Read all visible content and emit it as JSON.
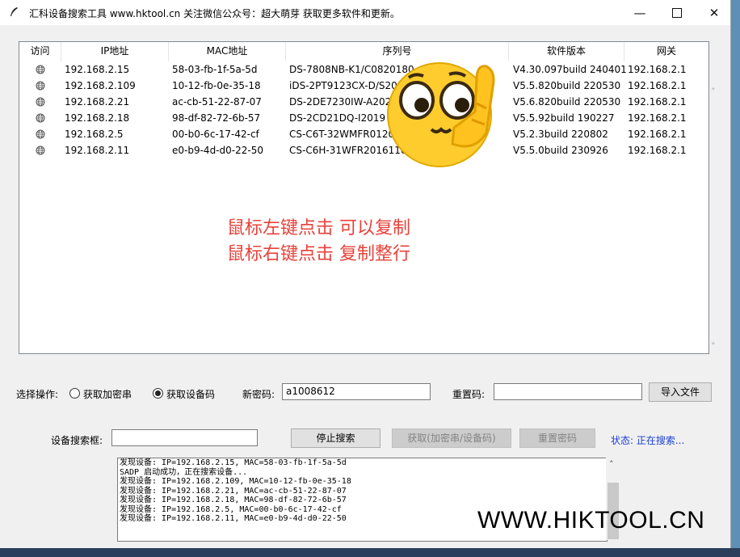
{
  "window": {
    "title": "汇科设备搜索工具  www.hktool.cn  关注微信公众号：超大萌芽  获取更多软件和更新。"
  },
  "table": {
    "columns": [
      "访问",
      "IP地址",
      "MAC地址",
      "序列号",
      "软件版本",
      "网关"
    ],
    "rows": [
      {
        "ip": "192.168.2.15",
        "mac": "58-03-fb-1f-5a-5d",
        "serial": "DS-7808NB-K1/C0820180",
        "version": "V4.30.097build 240401",
        "gateway": "192.168.2.1"
      },
      {
        "ip": "192.168.2.109",
        "mac": "10-12-fb-0e-35-18",
        "serial": "iDS-2PT9123CX-D/S20",
        "version": "V5.5.820build 220530",
        "gateway": "192.168.2.1"
      },
      {
        "ip": "192.168.2.21",
        "mac": "ac-cb-51-22-87-07",
        "serial": "DS-2DE7230IW-A202",
        "version": "V5.6.820build 220530",
        "gateway": "192.168.2.1"
      },
      {
        "ip": "192.168.2.18",
        "mac": "98-df-82-72-6b-57",
        "serial": "DS-2CD21DQ-I2019",
        "version": "V5.5.92build 190227",
        "gateway": "192.168.2.1"
      },
      {
        "ip": "192.168.2.5",
        "mac": "00-b0-6c-17-42-cf",
        "serial": "CS-C6T-32WMFR0120",
        "version": "V5.2.3build 220802",
        "gateway": "192.168.2.1"
      },
      {
        "ip": "192.168.2.11",
        "mac": "e0-b9-4d-d0-22-50",
        "serial": "CS-C6H-31WFR2016110",
        "version": "V5.5.0build 230926",
        "gateway": "192.168.2.1"
      }
    ]
  },
  "overlay": {
    "line1": "鼠标左键点击 可以复制",
    "line2": "鼠标右键点击 复制整行",
    "color": "#e8423a"
  },
  "controls": {
    "operation_label": "选择操作:",
    "radio_encrypt_label": "获取加密串",
    "radio_device_label": "获取设备码",
    "selected": "获取设备码",
    "new_password_label": "新密码:",
    "new_password_value": "a1008612",
    "reset_code_label": "重置码:",
    "reset_code_value": "",
    "import_button": "导入文件",
    "search_box_label": "设备搜索框:",
    "search_box_value": "",
    "stop_search_button": "停止搜索",
    "get_code_button": "获取(加密串/设备码)",
    "reset_password_button": "重置密码",
    "status_text": "状态: 正在搜索...",
    "status_color": "#1a3fd0"
  },
  "log": {
    "lines": [
      "发现设备: IP=192.168.2.15, MAC=58-03-fb-1f-5a-5d",
      "SADP 启动成功，正在搜索设备...",
      "发现设备: IP=192.168.2.109, MAC=10-12-fb-0e-35-18",
      "发现设备: IP=192.168.2.21, MAC=ac-cb-51-22-87-07",
      "发现设备: IP=192.168.2.18, MAC=98-df-82-72-6b-57",
      "发现设备: IP=192.168.2.5, MAC=00-b0-6c-17-42-cf",
      "发现设备: IP=192.168.2.11, MAC=e0-b9-4d-d0-22-50"
    ]
  },
  "watermark": "WWW.HIKTOOL.CN",
  "icons": {
    "app": "feather-pen-icon",
    "row": "globe-icon",
    "emoji": "thinking-face-sticker"
  }
}
